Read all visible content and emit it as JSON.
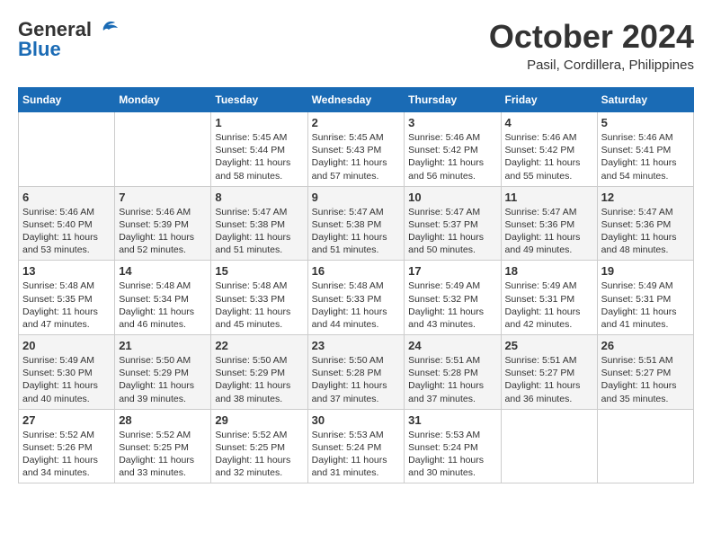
{
  "header": {
    "logo": {
      "general": "General",
      "blue": "Blue"
    },
    "title": "October 2024",
    "location": "Pasil, Cordillera, Philippines"
  },
  "weekdays": [
    "Sunday",
    "Monday",
    "Tuesday",
    "Wednesday",
    "Thursday",
    "Friday",
    "Saturday"
  ],
  "weeks": [
    [
      {
        "day": "",
        "info": ""
      },
      {
        "day": "",
        "info": ""
      },
      {
        "day": "1",
        "info": "Sunrise: 5:45 AM\nSunset: 5:44 PM\nDaylight: 11 hours and 58 minutes."
      },
      {
        "day": "2",
        "info": "Sunrise: 5:45 AM\nSunset: 5:43 PM\nDaylight: 11 hours and 57 minutes."
      },
      {
        "day": "3",
        "info": "Sunrise: 5:46 AM\nSunset: 5:42 PM\nDaylight: 11 hours and 56 minutes."
      },
      {
        "day": "4",
        "info": "Sunrise: 5:46 AM\nSunset: 5:42 PM\nDaylight: 11 hours and 55 minutes."
      },
      {
        "day": "5",
        "info": "Sunrise: 5:46 AM\nSunset: 5:41 PM\nDaylight: 11 hours and 54 minutes."
      }
    ],
    [
      {
        "day": "6",
        "info": "Sunrise: 5:46 AM\nSunset: 5:40 PM\nDaylight: 11 hours and 53 minutes."
      },
      {
        "day": "7",
        "info": "Sunrise: 5:46 AM\nSunset: 5:39 PM\nDaylight: 11 hours and 52 minutes."
      },
      {
        "day": "8",
        "info": "Sunrise: 5:47 AM\nSunset: 5:38 PM\nDaylight: 11 hours and 51 minutes."
      },
      {
        "day": "9",
        "info": "Sunrise: 5:47 AM\nSunset: 5:38 PM\nDaylight: 11 hours and 51 minutes."
      },
      {
        "day": "10",
        "info": "Sunrise: 5:47 AM\nSunset: 5:37 PM\nDaylight: 11 hours and 50 minutes."
      },
      {
        "day": "11",
        "info": "Sunrise: 5:47 AM\nSunset: 5:36 PM\nDaylight: 11 hours and 49 minutes."
      },
      {
        "day": "12",
        "info": "Sunrise: 5:47 AM\nSunset: 5:36 PM\nDaylight: 11 hours and 48 minutes."
      }
    ],
    [
      {
        "day": "13",
        "info": "Sunrise: 5:48 AM\nSunset: 5:35 PM\nDaylight: 11 hours and 47 minutes."
      },
      {
        "day": "14",
        "info": "Sunrise: 5:48 AM\nSunset: 5:34 PM\nDaylight: 11 hours and 46 minutes."
      },
      {
        "day": "15",
        "info": "Sunrise: 5:48 AM\nSunset: 5:33 PM\nDaylight: 11 hours and 45 minutes."
      },
      {
        "day": "16",
        "info": "Sunrise: 5:48 AM\nSunset: 5:33 PM\nDaylight: 11 hours and 44 minutes."
      },
      {
        "day": "17",
        "info": "Sunrise: 5:49 AM\nSunset: 5:32 PM\nDaylight: 11 hours and 43 minutes."
      },
      {
        "day": "18",
        "info": "Sunrise: 5:49 AM\nSunset: 5:31 PM\nDaylight: 11 hours and 42 minutes."
      },
      {
        "day": "19",
        "info": "Sunrise: 5:49 AM\nSunset: 5:31 PM\nDaylight: 11 hours and 41 minutes."
      }
    ],
    [
      {
        "day": "20",
        "info": "Sunrise: 5:49 AM\nSunset: 5:30 PM\nDaylight: 11 hours and 40 minutes."
      },
      {
        "day": "21",
        "info": "Sunrise: 5:50 AM\nSunset: 5:29 PM\nDaylight: 11 hours and 39 minutes."
      },
      {
        "day": "22",
        "info": "Sunrise: 5:50 AM\nSunset: 5:29 PM\nDaylight: 11 hours and 38 minutes."
      },
      {
        "day": "23",
        "info": "Sunrise: 5:50 AM\nSunset: 5:28 PM\nDaylight: 11 hours and 37 minutes."
      },
      {
        "day": "24",
        "info": "Sunrise: 5:51 AM\nSunset: 5:28 PM\nDaylight: 11 hours and 37 minutes."
      },
      {
        "day": "25",
        "info": "Sunrise: 5:51 AM\nSunset: 5:27 PM\nDaylight: 11 hours and 36 minutes."
      },
      {
        "day": "26",
        "info": "Sunrise: 5:51 AM\nSunset: 5:27 PM\nDaylight: 11 hours and 35 minutes."
      }
    ],
    [
      {
        "day": "27",
        "info": "Sunrise: 5:52 AM\nSunset: 5:26 PM\nDaylight: 11 hours and 34 minutes."
      },
      {
        "day": "28",
        "info": "Sunrise: 5:52 AM\nSunset: 5:25 PM\nDaylight: 11 hours and 33 minutes."
      },
      {
        "day": "29",
        "info": "Sunrise: 5:52 AM\nSunset: 5:25 PM\nDaylight: 11 hours and 32 minutes."
      },
      {
        "day": "30",
        "info": "Sunrise: 5:53 AM\nSunset: 5:24 PM\nDaylight: 11 hours and 31 minutes."
      },
      {
        "day": "31",
        "info": "Sunrise: 5:53 AM\nSunset: 5:24 PM\nDaylight: 11 hours and 30 minutes."
      },
      {
        "day": "",
        "info": ""
      },
      {
        "day": "",
        "info": ""
      }
    ]
  ]
}
